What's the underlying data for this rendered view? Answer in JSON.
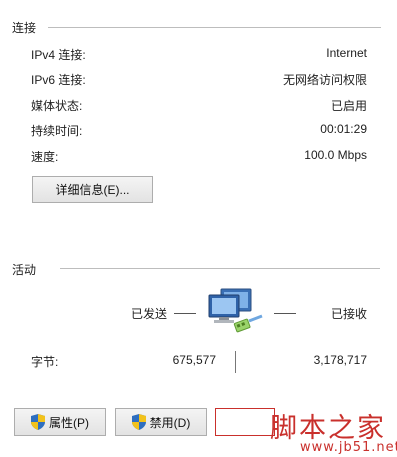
{
  "connection": {
    "title": "连接",
    "rows": [
      {
        "label": "IPv4 连接:",
        "value": "Internet"
      },
      {
        "label": "IPv6 连接:",
        "value": "无网络访问权限"
      },
      {
        "label": "媒体状态:",
        "value": "已启用"
      },
      {
        "label": "持续时间:",
        "value": "00:01:29"
      },
      {
        "label": "速度:",
        "value": "100.0 Mbps"
      }
    ],
    "details_button": "详细信息(E)..."
  },
  "activity": {
    "title": "活动",
    "sent_label": "已发送",
    "received_label": "已接收",
    "bytes_label": "字节:",
    "bytes_sent": "675,577",
    "bytes_received": "3,178,717"
  },
  "buttons": {
    "properties": "属性(P)",
    "disable": "禁用(D)"
  },
  "watermark": {
    "text": "脚本之家",
    "url": "www.jb51.net"
  },
  "colors": {
    "watermark": "#c9302c",
    "separator": "#bdbdbd"
  },
  "icons": {
    "network": "network-computers-icon",
    "shield": "uac-shield-icon"
  }
}
